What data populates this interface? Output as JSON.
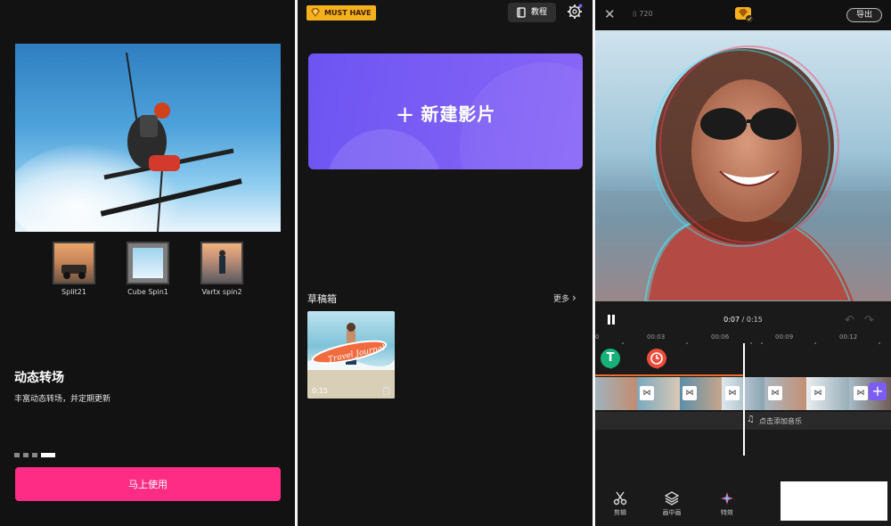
{
  "colors": {
    "accent_pink": "#fe2c85",
    "accent_purple": "#7b5cf5",
    "badge_gold": "#f5b01d",
    "panel_bg": "#121212"
  },
  "onboarding": {
    "thumbnails": [
      {
        "label": "Split21"
      },
      {
        "label": "Cube Spin1"
      },
      {
        "label": "Vartx spin2"
      }
    ],
    "title": "动态转场",
    "subtitle": "丰富动态转场，并定期更新",
    "page_indicator": {
      "count": 4,
      "active": 4
    },
    "cta_label": "马上使用"
  },
  "home": {
    "badge_label": "MUST HAVE",
    "tutorial_label": "教程",
    "new_project_label": "新建影片",
    "drafts_title": "草稿箱",
    "more_label": "更多",
    "draft": {
      "duration": "0:15",
      "title_overlay": "Travel Journal"
    }
  },
  "editor": {
    "resolution_label": "720",
    "export_label": "导出",
    "current_time": "0:07",
    "total_time": "0:15",
    "ruler_ticks": [
      "0",
      "00:03",
      "00:06",
      "00:09",
      "00:12"
    ],
    "text_track_letter": "T",
    "add_music_label": "点击添加音乐",
    "tools": [
      {
        "label": "剪辑",
        "icon": "scissors-icon"
      },
      {
        "label": "画中画",
        "icon": "layers-icon"
      },
      {
        "label": "特效",
        "icon": "sparkle-icon"
      }
    ]
  }
}
